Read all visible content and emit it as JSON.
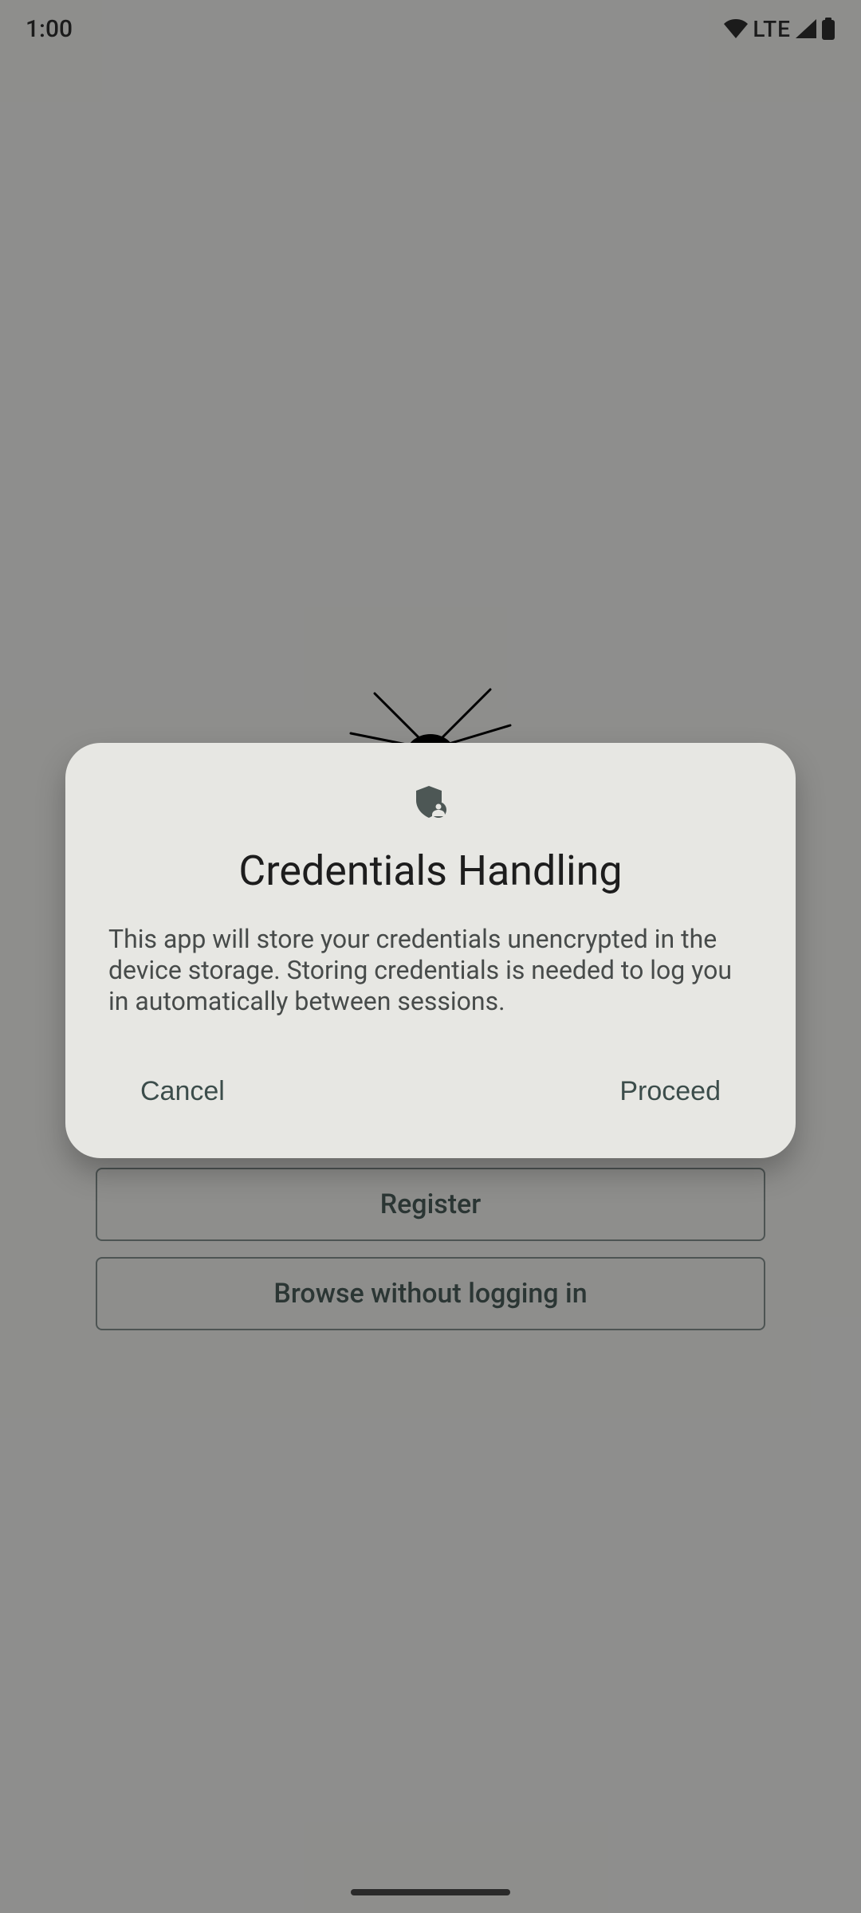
{
  "statusbar": {
    "time": "1:00",
    "network_label": "LTE"
  },
  "background": {
    "register_label": "Register",
    "browse_label": "Browse without logging in"
  },
  "dialog": {
    "title": "Credentials Handling",
    "body": "This app will store your credentials unencrypted in the device storage. Storing credentials is needed to log you in automatically between sessions.",
    "cancel_label": "Cancel",
    "proceed_label": "Proceed"
  }
}
